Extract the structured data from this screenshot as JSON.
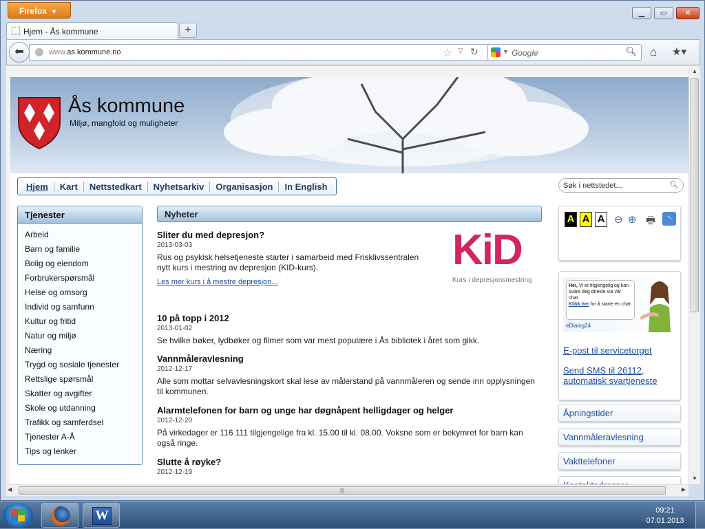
{
  "browser": {
    "app_button": "Firefox",
    "tab_title": "Hjem - Ås kommune",
    "url_prefix": "www.",
    "url_domain": "as.kommune.no",
    "search_placeholder": "Google"
  },
  "site": {
    "title": "Ås kommune",
    "tagline": "Miljø, mangfold og muligheter",
    "search_placeholder": "Søk i nettstedet...",
    "menu": [
      "Hjem",
      "Kart",
      "Nettstedkart",
      "Nyhetsarkiv",
      "Organisasjon",
      "In English"
    ]
  },
  "services": {
    "heading": "Tjenester",
    "items": [
      "Arbeid",
      "Barn og familie",
      "Bolig og eiendom",
      "Forbrukerspørsmål",
      "Helse og omsorg",
      "Individ og samfunn",
      "Kultur og fritid",
      "Natur og miljø",
      "Næring",
      "Trygd og sosiale tjenester",
      "Rettslige spørsmål",
      "Skatter og avgifter",
      "Skole og utdanning",
      "Trafikk og samferdsel",
      "Tjenester A-Å",
      "Tips og lenker"
    ]
  },
  "news": {
    "heading": "Nyheter",
    "items": [
      {
        "title": "Sliter du med depresjon?",
        "date": "2013-03-03",
        "text": "Rus og psykisk helsetjeneste starter i samarbeid med Frisklivssentralen nytt kurs i mestring av depresjon (KID-kurs).",
        "link": "Les mer kurs i å mestre depresjon..."
      },
      {
        "title": "10 på topp i 2012",
        "date": "2013-01-02",
        "text": "Se hvilke bøker, lydbøker og filmer som var mest populære i Ås bibliotek i året som gikk."
      },
      {
        "title": "Vannmåleravlesning",
        "date": "2012-12-17",
        "text": "Alle som mottar selvavlesningskort skal lese av målerstand på vannmåleren og sende inn opplysningen til kommunen."
      },
      {
        "title": "Alarmtelefonen for barn og unge har døgnåpent helligdager og helger",
        "date": "2012-12-20",
        "text": "På virkedager er 116 111 tilgjengelige fra kl. 15.00 til kl. 08.00. Voksne som er bekymret for barn kan også ringe."
      },
      {
        "title": "Slutte å røyke?",
        "date": "2012-12-19"
      }
    ],
    "kid_logo": {
      "big": "KiD",
      "sub": "Kurs i depresjonsmestring"
    }
  },
  "tools": {
    "font_sizes": [
      "A",
      "A",
      "A"
    ],
    "icons": [
      "zoom-out-icon",
      "zoom-in-icon",
      "print-icon",
      "rss-icon"
    ]
  },
  "chat": {
    "bubble_greeting": "Hei,",
    "bubble_text": "Vi er tilgjengelig og kan svare deg direkte via vår chat.",
    "bubble_link": "Klikk her",
    "bubble_link_rest": "for å starte en chat",
    "brand": "eDialog24",
    "email_link": "E-post til servicetorget",
    "sms_link": "Send SMS til 26112, automatisk svartjeneste"
  },
  "quicklinks": [
    "Åpningstider",
    "Vannmåleravlesning",
    "Vakttelefoner",
    "Kontaktadresser"
  ],
  "taskbar": {
    "time": "09:21",
    "date": "07.01.2013"
  },
  "colors": {
    "brand_red": "#d2232a",
    "kid_pink": "#d4265e",
    "link_blue": "#1f4fa0",
    "firefox_orange": "#e07a12"
  }
}
